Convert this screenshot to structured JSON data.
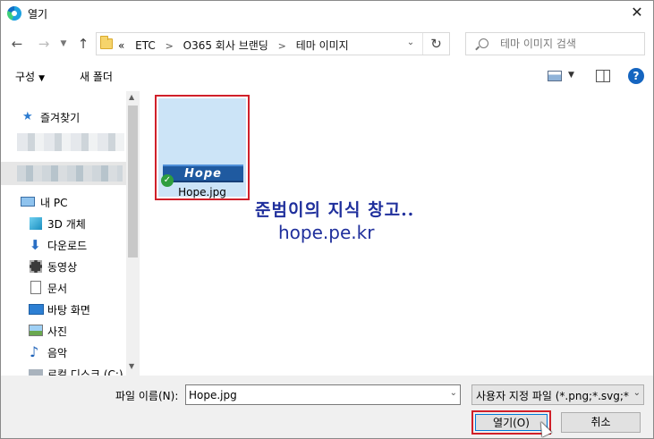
{
  "window": {
    "title": "열기",
    "close": "✕"
  },
  "nav": {
    "back": "←",
    "forward": "→",
    "recent": "⌄",
    "up": "↑",
    "breadcrumb_prefix": "«",
    "breadcrumbs": [
      "ETC",
      "O365 회사 브랜딩",
      "테마 이미지"
    ],
    "refresh": "↻",
    "search_placeholder": "테마 이미지 검색"
  },
  "toolbar": {
    "organize": "구성",
    "new_folder": "새 폴더",
    "help": "?"
  },
  "sidebar": {
    "favorites": "즐겨찾기",
    "this_pc": "내 PC",
    "items": [
      "3D 개체",
      "다운로드",
      "동영상",
      "문서",
      "바탕 화면",
      "사진",
      "음악",
      "로컬 디스크 (C:)"
    ]
  },
  "files": [
    {
      "name": "Hope.jpg",
      "thumb_text": "Hope",
      "selected": true
    }
  ],
  "watermark": {
    "line1": "준범이의 지식 창고..",
    "line2": "hope.pe.kr"
  },
  "bottom": {
    "filename_label": "파일 이름(N):",
    "filename_value": "Hope.jpg",
    "filter_value": "사용자 지정 파일 (*.png;*.svg;*",
    "open_label": "열기(O)",
    "cancel_label": "취소"
  }
}
